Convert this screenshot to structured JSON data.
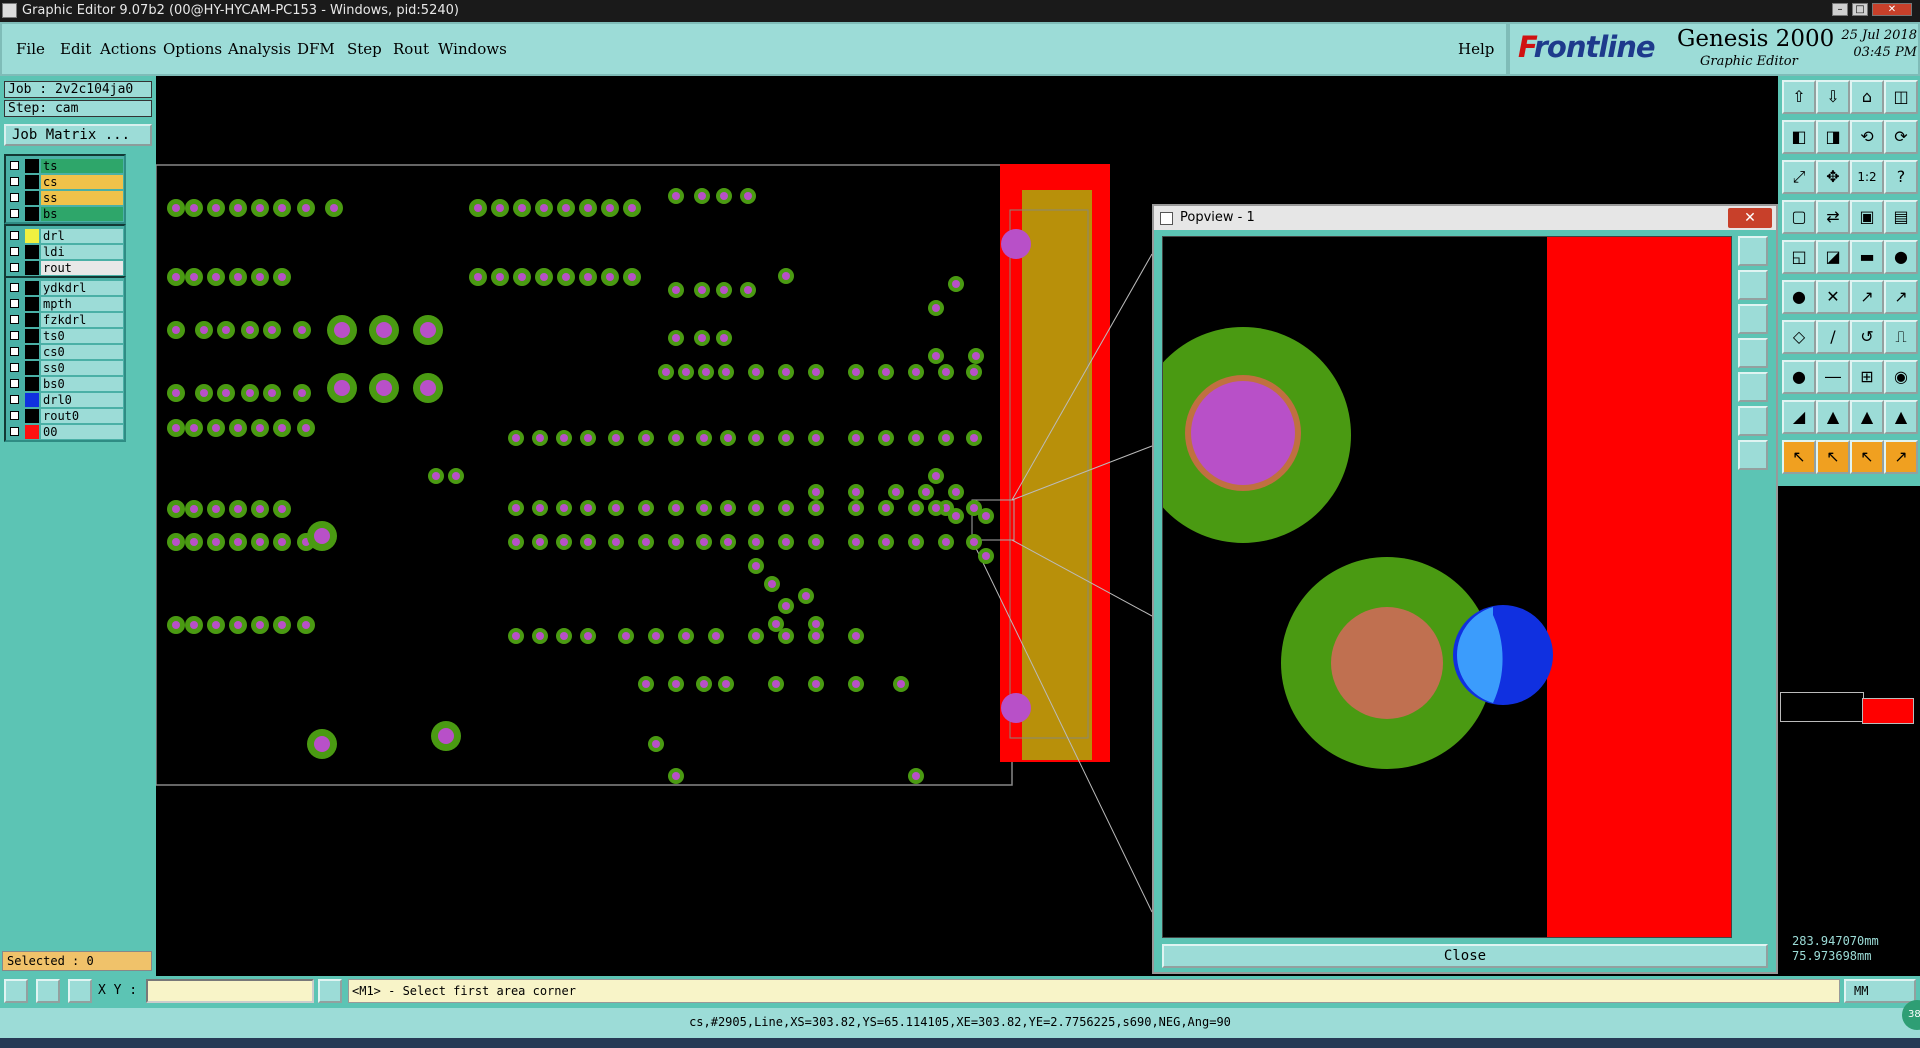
{
  "window": {
    "title": "Graphic Editor 9.07b2 (00@HY-HYCAM-PC153 - Windows, pid:5240)"
  },
  "menu": [
    "File",
    "Edit",
    "Actions",
    "Options",
    "Analysis",
    "DFM",
    "Step",
    "Rout",
    "Windows"
  ],
  "help_label": "Help",
  "brand": {
    "logo_f": "F",
    "logo_rest": "rontline",
    "product": "Genesis 2000",
    "subtitle": "Graphic Editor",
    "date": "25 Jul 2018",
    "time": "03:45 PM"
  },
  "job": {
    "job_label": "Job : 2v2c104ja0",
    "step_label": "Step: cam",
    "matrix_button": "Job Matrix ..."
  },
  "layers": {
    "group1": [
      {
        "name": "ts",
        "color": "#2ea66a"
      },
      {
        "name": "cs",
        "color": "#f0c24a"
      },
      {
        "name": "ss",
        "color": "#f0c24a"
      },
      {
        "name": "bs",
        "color": "#2ea66a"
      }
    ],
    "group2": [
      {
        "name": "drl",
        "color": "#9cdcd7",
        "swatch": "#f0f040"
      },
      {
        "name": "ldi",
        "color": "#9cdcd7"
      },
      {
        "name": "rout",
        "color": "#e8e8e8"
      }
    ],
    "group3": [
      {
        "name": "ydkdrl",
        "color": "#9cdcd7"
      },
      {
        "name": "mpth",
        "color": "#9cdcd7"
      },
      {
        "name": "fzkdrl",
        "color": "#9cdcd7"
      },
      {
        "name": "ts0",
        "color": "#9cdcd7"
      },
      {
        "name": "cs0",
        "color": "#9cdcd7"
      },
      {
        "name": "ss0",
        "color": "#9cdcd7"
      },
      {
        "name": "bs0",
        "color": "#9cdcd7"
      },
      {
        "name": "drl0",
        "color": "#9cdcd7",
        "swatch": "#1030e0"
      },
      {
        "name": "rout0",
        "color": "#9cdcd7"
      },
      {
        "name": "00",
        "color": "#9cdcd7",
        "swatch": "#ff1010"
      }
    ]
  },
  "selected_label": "Selected : 0",
  "popview": {
    "title": "Popview - 1",
    "close_label": "Close"
  },
  "coords": {
    "x": "283.947070mm",
    "y": "75.973698mm"
  },
  "command": {
    "xy_label": "X Y :",
    "xy_value": "",
    "prompt": "<M1> - Select first area corner",
    "units": "MM"
  },
  "status": "cs,#2905,Line,XS=303.82,YS=65.114105,XE=303.82,YE=2.7756225,s690,NEG,Ang=90",
  "colors": {
    "pad_ring": "#4a9a12",
    "pad_hole": "#b850c8",
    "board_edge": "#ff0000",
    "gold_strip": "#b8900a",
    "panel_bg": "#5cc4b4"
  }
}
